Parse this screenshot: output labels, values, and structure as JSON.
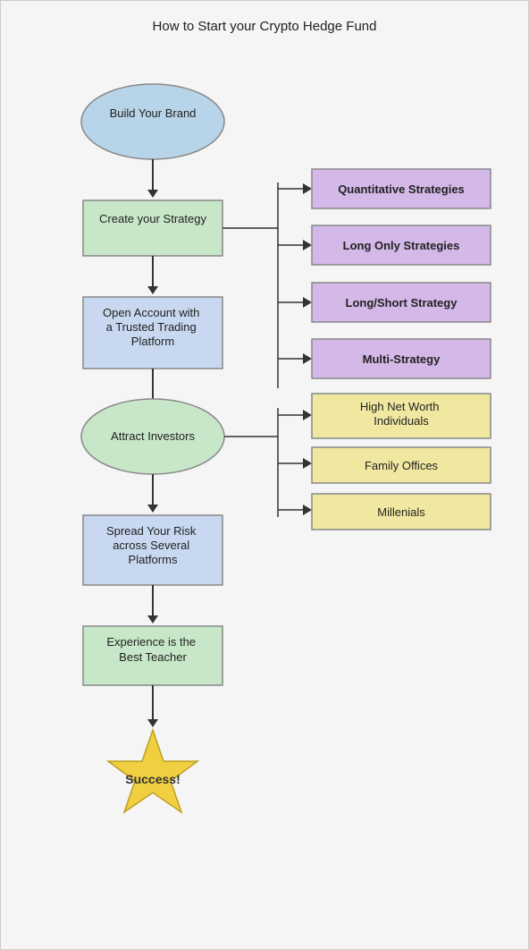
{
  "title": "How to Start your Crypto Hedge Fund",
  "nodes": [
    {
      "id": "brand",
      "label": "Build Your Brand",
      "type": "ellipse",
      "color": "blue-ellipse"
    },
    {
      "id": "strategy",
      "label": "Create your Strategy",
      "type": "rect",
      "color": "green-rect"
    },
    {
      "id": "account",
      "label": "Open Account with a Trusted Trading Platform",
      "type": "rect",
      "color": "blue-rect"
    },
    {
      "id": "investors",
      "label": "Attract Investors",
      "type": "ellipse",
      "color": "green-ellipse"
    },
    {
      "id": "spread",
      "label": "Spread Your Risk across Several Platforms",
      "type": "rect",
      "color": "blue-rect"
    },
    {
      "id": "experience",
      "label": "Experience is the Best Teacher",
      "type": "rect",
      "color": "green-rect"
    }
  ],
  "star": {
    "label": "Success!",
    "color": "#f0d040"
  },
  "branches_strategy": [
    {
      "label": "Quantitative Strategies",
      "color": "purple"
    },
    {
      "label": "Long Only Strategies",
      "color": "purple"
    },
    {
      "label": "Long/Short Strategy",
      "color": "purple"
    },
    {
      "label": "Multi-Strategy",
      "color": "purple"
    }
  ],
  "branches_investors": [
    {
      "label": "High Net Worth Individuals",
      "color": "yellow"
    },
    {
      "label": "Family Offices",
      "color": "yellow"
    },
    {
      "label": "Millenials",
      "color": "yellow"
    }
  ]
}
